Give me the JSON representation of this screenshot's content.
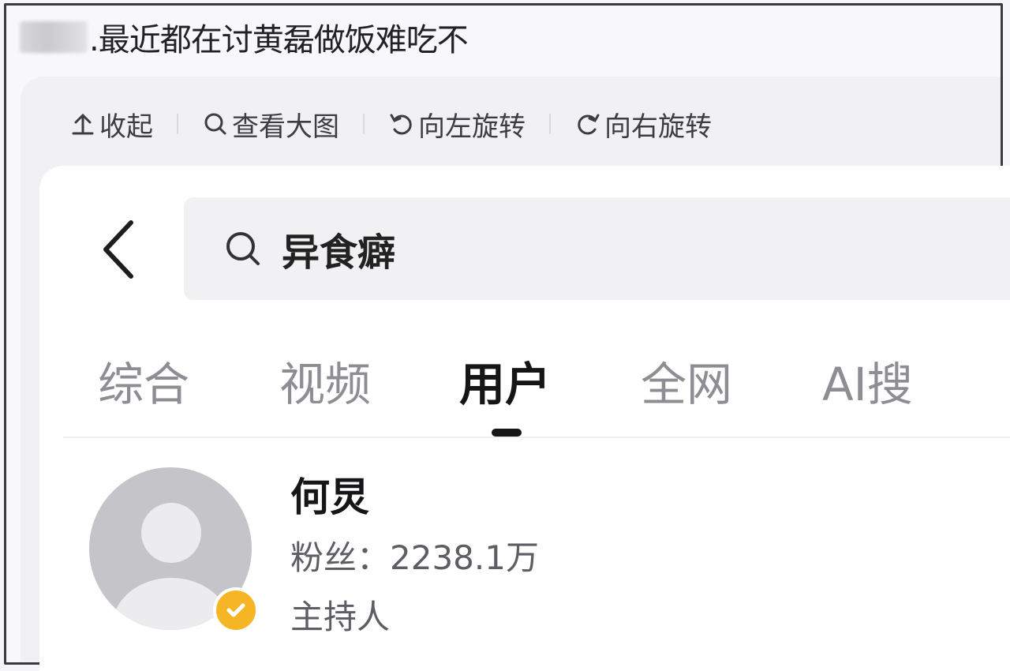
{
  "post": {
    "title": ".最近都在讨黄磊做饭难吃不"
  },
  "toolbar": {
    "collapse": "收起",
    "view_large": "查看大图",
    "rotate_left": "向左旋转",
    "rotate_right": "向右旋转"
  },
  "search": {
    "query": "异食癖"
  },
  "tabs": [
    "综合",
    "视频",
    "用户",
    "全网",
    "AI搜"
  ],
  "active_tab": "用户",
  "user": {
    "name": "何炅",
    "fans_label": "粉丝：",
    "fans_value": "2238.1万",
    "role": "主持人"
  },
  "icons": [
    "arrow-up-icon",
    "search-icon",
    "rotate-left-icon",
    "rotate-right-icon",
    "back-arrow-icon",
    "verified-check-icon"
  ],
  "colors": {
    "verified_badge": "#f5b524",
    "active_tab": "#151518",
    "inactive_tab": "#8d8d93"
  }
}
